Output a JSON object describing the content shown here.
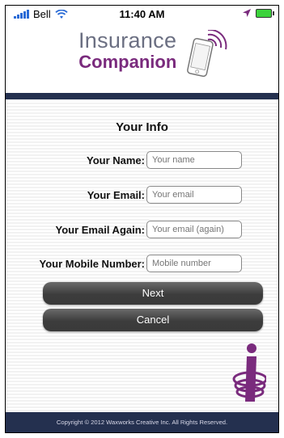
{
  "status_bar": {
    "carrier": "Bell",
    "time": "11:40 AM"
  },
  "logo": {
    "line1": "Insurance",
    "line2": "Companion"
  },
  "form": {
    "title": "Your Info",
    "fields": [
      {
        "label": "Your Name:",
        "placeholder": "Your name"
      },
      {
        "label": "Your Email:",
        "placeholder": "Your email"
      },
      {
        "label": "Your Email Again:",
        "placeholder": "Your email (again)"
      },
      {
        "label": "Your Mobile Number:",
        "placeholder": "Mobile number"
      }
    ],
    "next_label": "Next",
    "cancel_label": "Cancel"
  },
  "footer": {
    "copyright": "Copyright © 2012 Waxworks Creative Inc. All Rights Reserved."
  },
  "colors": {
    "brand_navy": "#24304f",
    "brand_purple": "#7a2b7d",
    "logo_gray": "#6b6f82"
  }
}
